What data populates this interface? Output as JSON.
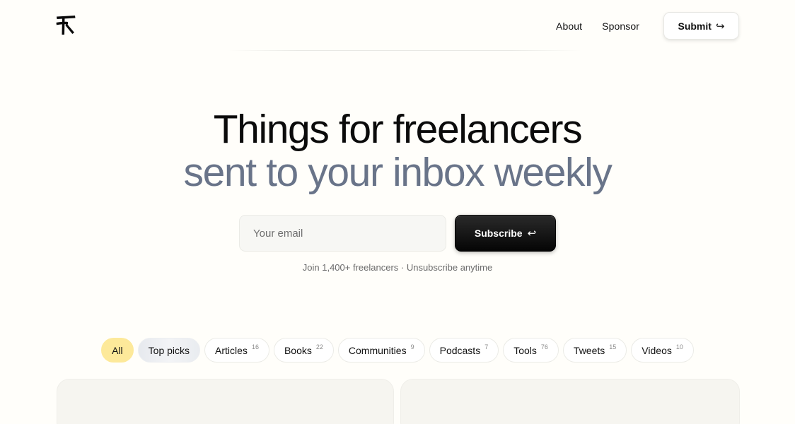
{
  "logo": {
    "icon": "f-monogram-logo"
  },
  "nav": {
    "about": "About",
    "sponsor": "Sponsor",
    "submit": "Submit",
    "submit_icon": "arrow-forward-icon"
  },
  "hero": {
    "line1": "Things for freelancers",
    "line2": "sent to your inbox weekly"
  },
  "signup": {
    "email_placeholder": "Your email",
    "subscribe": "Subscribe",
    "subscribe_icon": "enter-return-icon",
    "note": "Join 1,400+ freelancers · Unsubscribe anytime"
  },
  "filters": [
    {
      "label": "All",
      "count": ""
    },
    {
      "label": "Top picks",
      "count": ""
    },
    {
      "label": "Articles",
      "count": "16"
    },
    {
      "label": "Books",
      "count": "22"
    },
    {
      "label": "Communities",
      "count": "9"
    },
    {
      "label": "Podcasts",
      "count": "7"
    },
    {
      "label": "Tools",
      "count": "76"
    },
    {
      "label": "Tweets",
      "count": "15"
    },
    {
      "label": "Videos",
      "count": "10"
    }
  ],
  "colors": {
    "background": "#fffefa",
    "accent_yellow": "#fde99a",
    "hero_muted": "#697489",
    "button_dark": "#0b0b0b"
  }
}
